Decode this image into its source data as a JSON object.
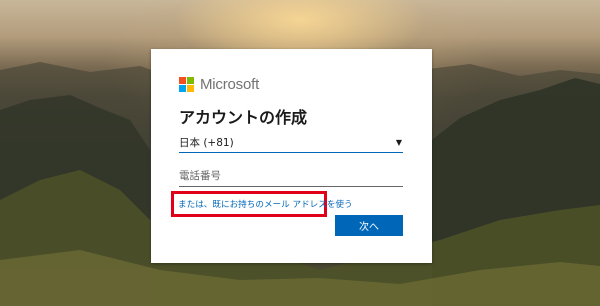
{
  "brand": {
    "name": "Microsoft",
    "logo_colors": [
      "#f25022",
      "#7fba00",
      "#00a4ef",
      "#ffb900"
    ]
  },
  "form": {
    "title": "アカウントの作成",
    "country_select": {
      "value": "日本 (+81)"
    },
    "phone_input": {
      "placeholder": "電話番号",
      "value": ""
    },
    "alt_link": "または、既にお持ちのメール アドレスを使う",
    "next_button": "次へ"
  },
  "colors": {
    "accent": "#0067b8",
    "highlight_box": "#e0001a"
  },
  "icons": {
    "country_dropdown": "chevron-down-icon"
  }
}
